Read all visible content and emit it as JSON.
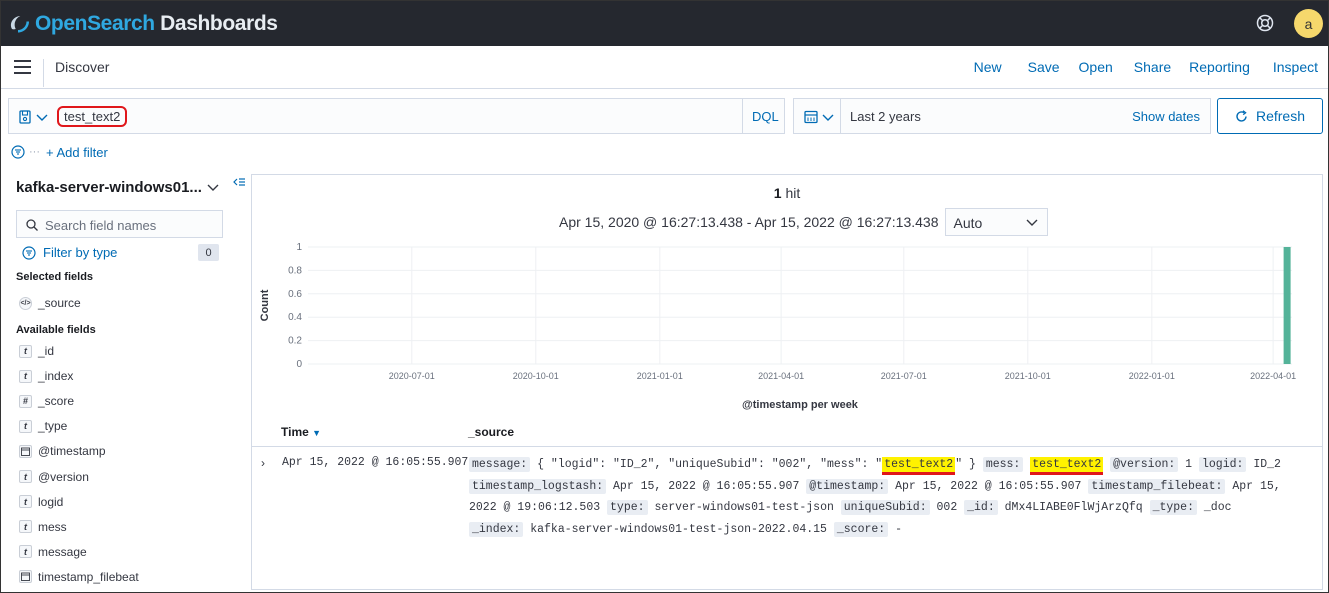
{
  "header": {
    "brand_primary": "OpenSearch",
    "brand_secondary": "Dashboards",
    "avatar_initial": "a"
  },
  "subheader": {
    "breadcrumb": "Discover",
    "links": [
      "New",
      "Save",
      "Open",
      "Share",
      "Reporting",
      "Inspect"
    ]
  },
  "query": {
    "value": "test_text2",
    "language": "DQL"
  },
  "time": {
    "label": "Last 2 years",
    "show_dates": "Show dates",
    "refresh": "Refresh"
  },
  "filters": {
    "add_filter": "+ Add filter"
  },
  "sidebar": {
    "index_pattern": "kafka-server-windows01...",
    "search_placeholder": "Search field names",
    "filter_by_type": "Filter by type",
    "filter_count": "0",
    "selected_title": "Selected fields",
    "selected_fields": [
      {
        "name": "_source",
        "type": "source"
      }
    ],
    "available_title": "Available fields",
    "available_fields": [
      {
        "name": "_id",
        "type": "t"
      },
      {
        "name": "_index",
        "type": "t"
      },
      {
        "name": "_score",
        "type": "#"
      },
      {
        "name": "_type",
        "type": "t"
      },
      {
        "name": "@timestamp",
        "type": "date"
      },
      {
        "name": "@version",
        "type": "t"
      },
      {
        "name": "logid",
        "type": "t"
      },
      {
        "name": "mess",
        "type": "t"
      },
      {
        "name": "message",
        "type": "t"
      },
      {
        "name": "timestamp_filebeat",
        "type": "date"
      }
    ]
  },
  "results": {
    "hit_count": "1",
    "hit_word": "hit",
    "range": "Apr 15, 2020 @ 16:27:13.438 - Apr 15, 2022 @ 16:27:13.438",
    "interval": "Auto",
    "col_time": "Time",
    "col_source": "_source",
    "row": {
      "time": "Apr 15, 2022 @ 16:05:55.907"
    }
  },
  "chart_data": {
    "type": "bar",
    "ylabel": "Count",
    "xlabel": "@timestamp per week",
    "ylim": [
      0,
      1
    ],
    "yticks": [
      "1",
      "0.8",
      "0.6",
      "0.4",
      "0.2",
      "0"
    ],
    "x_ticks": [
      "2020-07-01",
      "2020-10-01",
      "2021-01-01",
      "2021-04-01",
      "2021-07-01",
      "2021-10-01",
      "2022-01-01",
      "2022-04-01"
    ],
    "series": [
      {
        "x": [
          "2022-04-11"
        ],
        "values": [
          1
        ]
      }
    ],
    "bar_color": "#54b399"
  }
}
